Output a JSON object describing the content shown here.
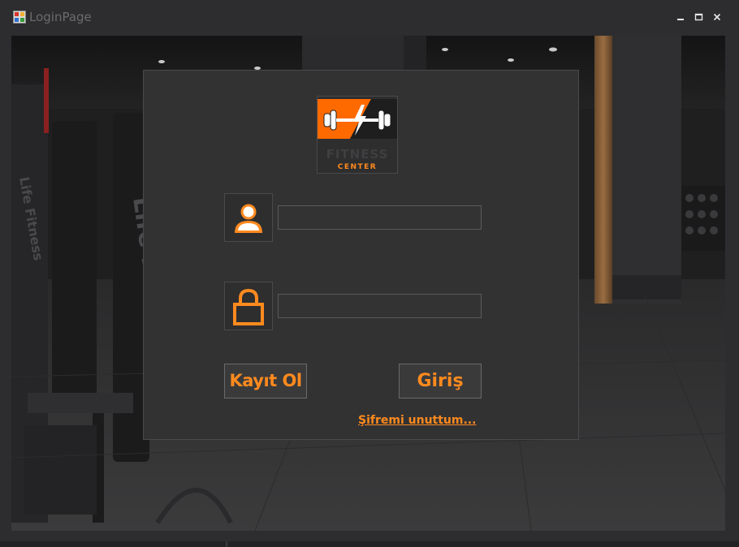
{
  "window": {
    "title": "LoginPage",
    "controls": {
      "minimize": "🗕",
      "maximize": "🗖",
      "close": "✕"
    }
  },
  "logo": {
    "line1": "FITNESS",
    "line2": "CENTER"
  },
  "form": {
    "username_icon": "user-icon",
    "password_icon": "lock-icon",
    "username_value": "",
    "password_value": "",
    "register_label": "Kayıt Ol",
    "login_label": "Giriş",
    "forgot_label": "Şifremi unuttum..."
  },
  "colors": {
    "accent": "#ff8a1e",
    "panel": "#323233",
    "window": "#2d2d30"
  }
}
